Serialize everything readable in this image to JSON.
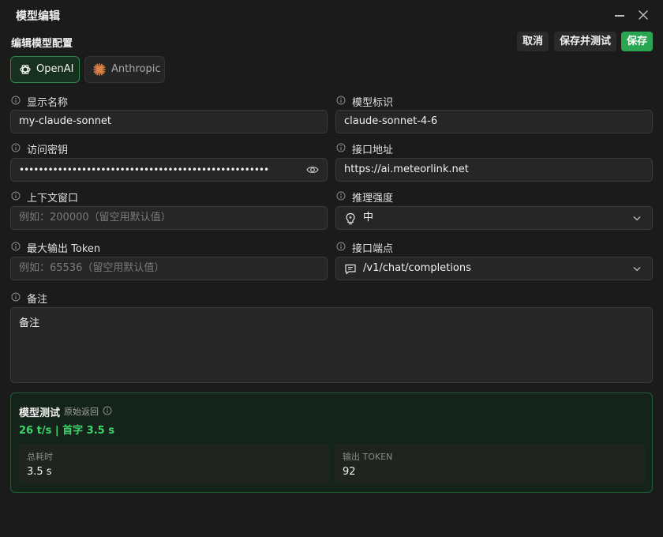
{
  "window": {
    "title": "模型编辑"
  },
  "header": {
    "section_title": "编辑模型配置",
    "cancel_label": "取消",
    "save_test_label": "保存并测试",
    "save_label": "保存"
  },
  "providers": [
    {
      "label": "OpenAI",
      "selected": true
    },
    {
      "label": "Anthropic",
      "selected": false
    }
  ],
  "fields": {
    "display_name": {
      "label": "显示名称",
      "value": "my-claude-sonnet"
    },
    "model_id": {
      "label": "模型标识",
      "value": "claude-sonnet-4-6"
    },
    "api_key": {
      "label": "访问密钥",
      "value": "••••••••••••••••••••••••••••••••••••••••••••••••••••"
    },
    "endpoint_url": {
      "label": "接口地址",
      "value": "https://ai.meteorlink.net"
    },
    "context_window": {
      "label": "上下文窗口",
      "placeholder": "例如：200000（留空用默认值）"
    },
    "reasoning": {
      "label": "推理强度",
      "value": "中"
    },
    "max_tokens": {
      "label": "最大输出 Token",
      "placeholder": "例如：65536（留空用默认值）"
    },
    "api_path": {
      "label": "接口端点",
      "value": "/v1/chat/completions"
    },
    "notes": {
      "label": "备注",
      "value": "备注"
    }
  },
  "test": {
    "title": "模型测试",
    "subtitle": "原始返回",
    "speed_line": "26 t/s | 首字 3.5 s",
    "stats": [
      {
        "label": "总耗时",
        "value": "3.5 s"
      },
      {
        "label": "输出 TOKEN",
        "value": "92"
      }
    ]
  },
  "colors": {
    "accent": "#2aa552",
    "speed": "#3fd46b",
    "background": "#1b1b1b"
  }
}
